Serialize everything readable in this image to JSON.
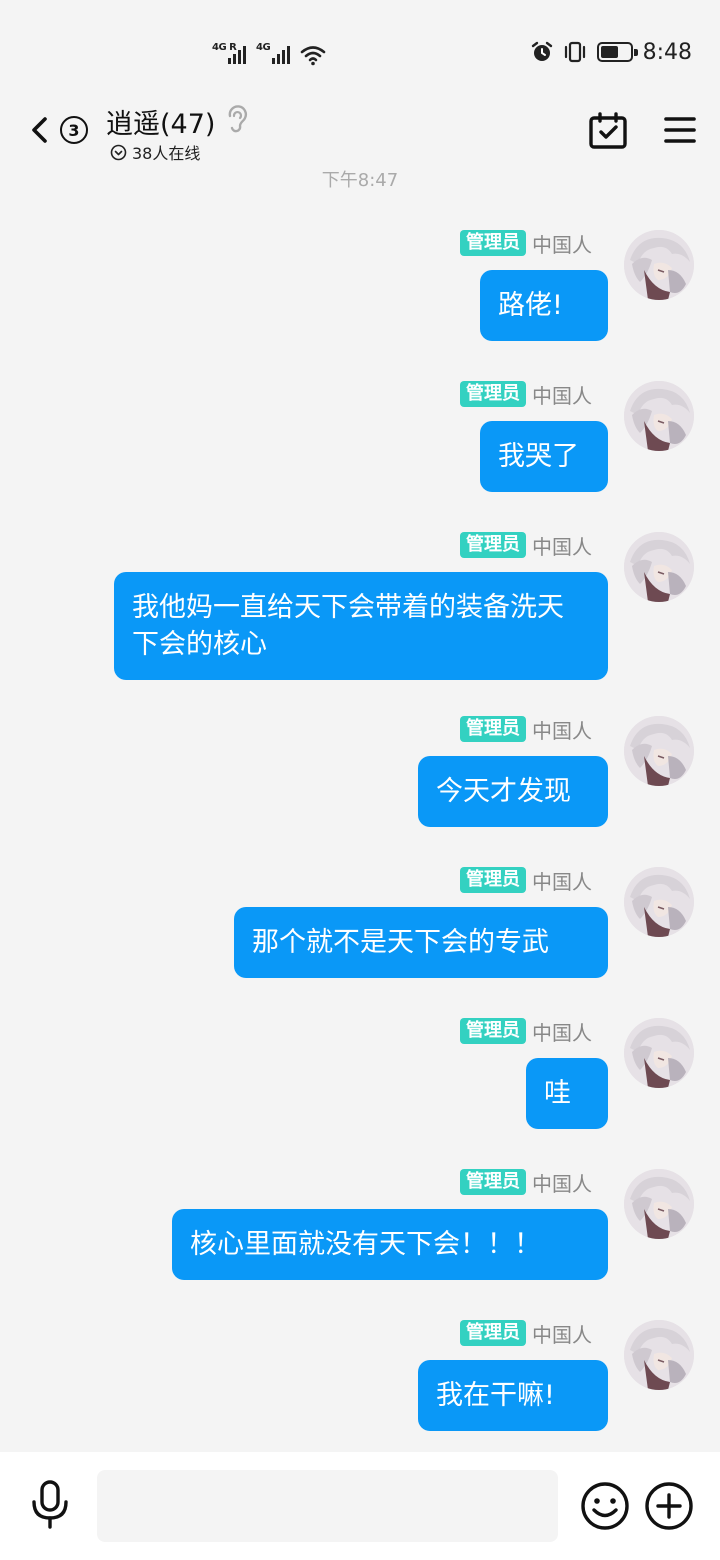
{
  "status_bar": {
    "signal1_label": "4G R",
    "signal2_label": "4G",
    "time": "8:48"
  },
  "header": {
    "unread_count": "3",
    "title": "逍遥(47)",
    "online_text": "38人在线"
  },
  "chat": {
    "time_divider": "下午8:47",
    "messages": [
      {
        "badge": "管理员",
        "nick": "中国人",
        "text": "路佬!"
      },
      {
        "badge": "管理员",
        "nick": "中国人",
        "text": "我哭了"
      },
      {
        "badge": "管理员",
        "nick": "中国人",
        "text": "我他妈一直给天下会带着的装备洗天下会的核心"
      },
      {
        "badge": "管理员",
        "nick": "中国人",
        "text": "今天才发现"
      },
      {
        "badge": "管理员",
        "nick": "中国人",
        "text": "那个就不是天下会的专武"
      },
      {
        "badge": "管理员",
        "nick": "中国人",
        "text": "哇"
      },
      {
        "badge": "管理员",
        "nick": "中国人",
        "text": "核心里面就没有天下会！！！"
      },
      {
        "badge": "管理员",
        "nick": "中国人",
        "text": "我在干嘛!"
      }
    ]
  },
  "input_bar": {
    "value": "",
    "placeholder": ""
  },
  "colors": {
    "bubble": "#0a98f7",
    "admin_badge": "#33d1c1",
    "background": "#f4f4f4"
  },
  "icons": {
    "back": "chevron-left-icon",
    "ear": "ear-icon",
    "online": "chevron-down-circle-icon",
    "calendar": "calendar-check-icon",
    "menu": "hamburger-menu-icon",
    "mic": "microphone-icon",
    "emoji": "emoji-icon",
    "plus": "plus-circle-icon"
  }
}
